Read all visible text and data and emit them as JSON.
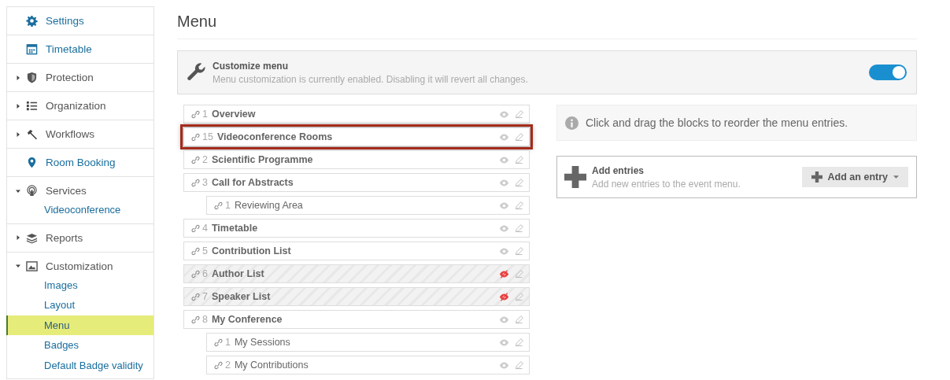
{
  "sidebar": {
    "items": [
      {
        "kind": "link",
        "label": "Settings"
      },
      {
        "kind": "link",
        "label": "Timetable"
      },
      {
        "kind": "section",
        "label": "Protection",
        "expanded": false
      },
      {
        "kind": "section",
        "label": "Organization",
        "expanded": false
      },
      {
        "kind": "section",
        "label": "Workflows",
        "expanded": false
      },
      {
        "kind": "link",
        "label": "Room Booking"
      },
      {
        "kind": "section",
        "label": "Services",
        "expanded": true,
        "children": [
          {
            "label": "Videoconference",
            "selected": false
          }
        ]
      },
      {
        "kind": "section",
        "label": "Reports",
        "expanded": false
      },
      {
        "kind": "section",
        "label": "Customization",
        "expanded": true,
        "children": [
          {
            "label": "Images",
            "selected": false
          },
          {
            "label": "Layout",
            "selected": false
          },
          {
            "label": "Menu",
            "selected": true
          },
          {
            "label": "Badges",
            "selected": false
          },
          {
            "label": "Default Badge validity",
            "selected": false
          }
        ]
      }
    ]
  },
  "page_title": "Menu",
  "customize": {
    "title": "Customize menu",
    "description": "Menu customization is currently enabled. Disabling it will revert all changes.",
    "on": true
  },
  "entries": [
    {
      "number": "1",
      "title": "Overview",
      "visible": true,
      "highlighted": false
    },
    {
      "number": "15",
      "title": "Videoconference Rooms",
      "visible": true,
      "highlighted": true
    },
    {
      "number": "2",
      "title": "Scientific Programme",
      "visible": true,
      "highlighted": false
    },
    {
      "number": "3",
      "title": "Call for Abstracts",
      "visible": true,
      "highlighted": false,
      "children": [
        {
          "number": "1",
          "title": "Reviewing Area",
          "visible": true,
          "highlighted": false
        }
      ]
    },
    {
      "number": "4",
      "title": "Timetable",
      "visible": true,
      "highlighted": false
    },
    {
      "number": "5",
      "title": "Contribution List",
      "visible": true,
      "highlighted": false
    },
    {
      "number": "6",
      "title": "Author List",
      "visible": false,
      "highlighted": false
    },
    {
      "number": "7",
      "title": "Speaker List",
      "visible": false,
      "highlighted": false
    },
    {
      "number": "8",
      "title": "My Conference",
      "visible": true,
      "highlighted": false,
      "children": [
        {
          "number": "1",
          "title": "My Sessions",
          "visible": true,
          "highlighted": false
        },
        {
          "number": "2",
          "title": "My Contributions",
          "visible": true,
          "highlighted": false
        }
      ]
    }
  ],
  "info": "Click and drag the blocks to reorder the menu entries.",
  "add_panel": {
    "title": "Add entries",
    "description": "Add new entries to the event menu.",
    "button": "Add an entry"
  }
}
